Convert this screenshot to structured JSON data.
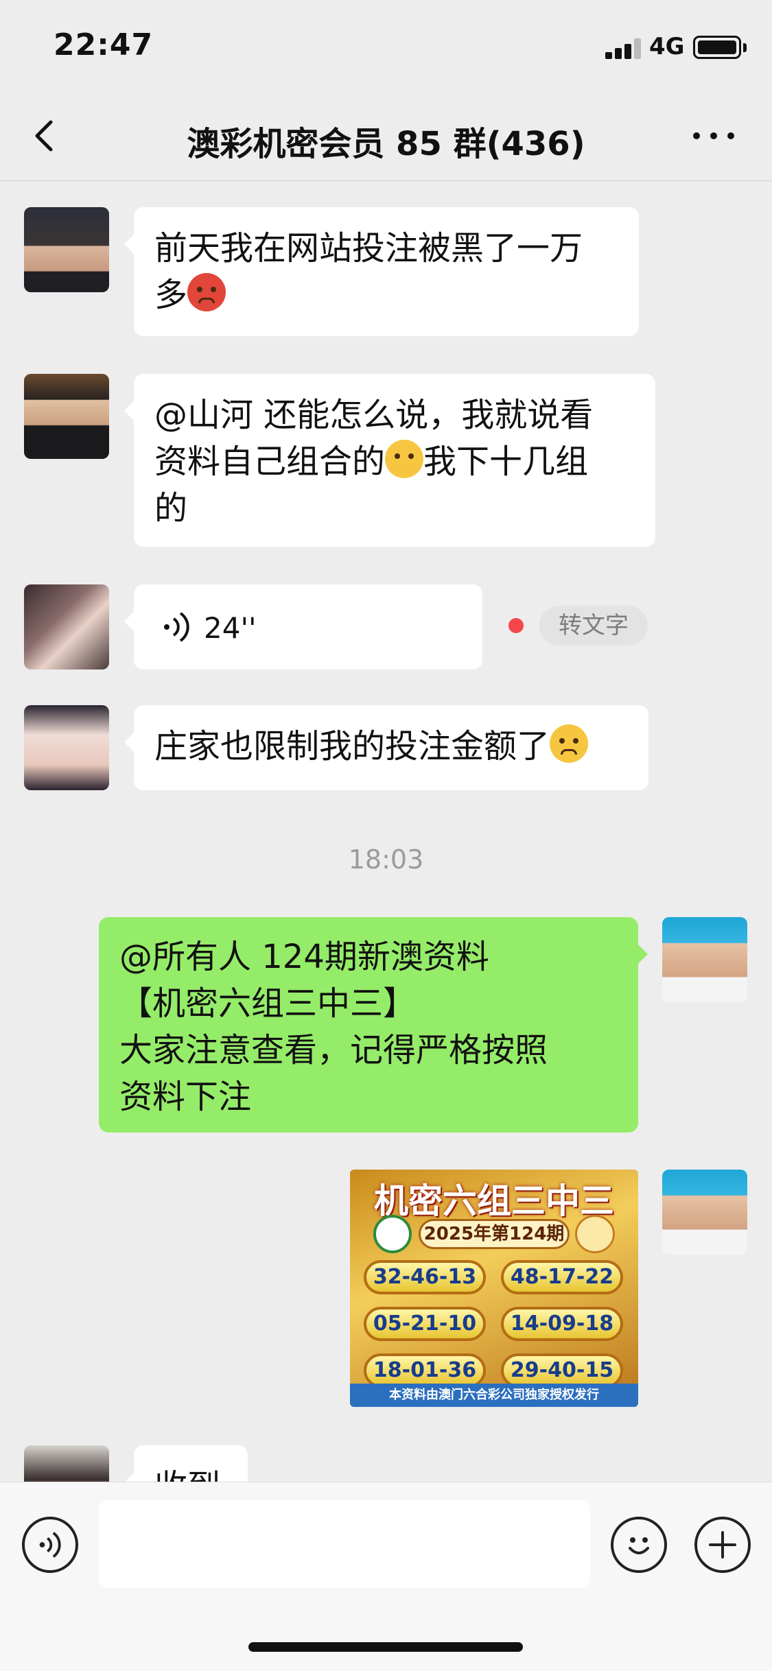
{
  "status_bar": {
    "time": "22:47",
    "network": "4G"
  },
  "nav": {
    "title": "澳彩机密会员 85 群(436)"
  },
  "messages": [
    {
      "side": "left",
      "text_line1": "前天我在网站投注被黑了一万",
      "text_line2": "多",
      "emoji": "angry-face-emoji"
    },
    {
      "side": "left",
      "text_line1": "@山河  还能怎么说，我就说看",
      "text_line2a": "资料自己组合的",
      "text_line2b": "我下十几组",
      "text_line3": "的",
      "emoji": "thinking-face-emoji"
    },
    {
      "side": "left",
      "type": "voice",
      "duration": "24''",
      "transcribe_label": "转文字"
    },
    {
      "side": "left",
      "text": "庄家也限制我的投注金额了",
      "emoji": "crying-face-emoji"
    },
    {
      "side": "right",
      "line1": "@所有人   124期新澳资料",
      "line2": "【机密六组三中三】",
      "line3": "大家注意查看，记得严格按照",
      "line4": "资料下注"
    },
    {
      "side": "left",
      "text": "收到"
    }
  ],
  "timestamp": "18:03",
  "poster": {
    "title": "机密六组三中三",
    "issue": "2025年第124期",
    "combos": [
      "32-46-13",
      "48-17-22",
      "05-21-10",
      "14-09-18",
      "18-01-36",
      "29-40-15"
    ],
    "footer": "本资料由澳门六合彩公司独家授权发行"
  },
  "input": {
    "placeholder": ""
  },
  "colors": {
    "bubble_self": "#95ec69",
    "background": "#ededed",
    "unread_dot": "#f2464b"
  }
}
